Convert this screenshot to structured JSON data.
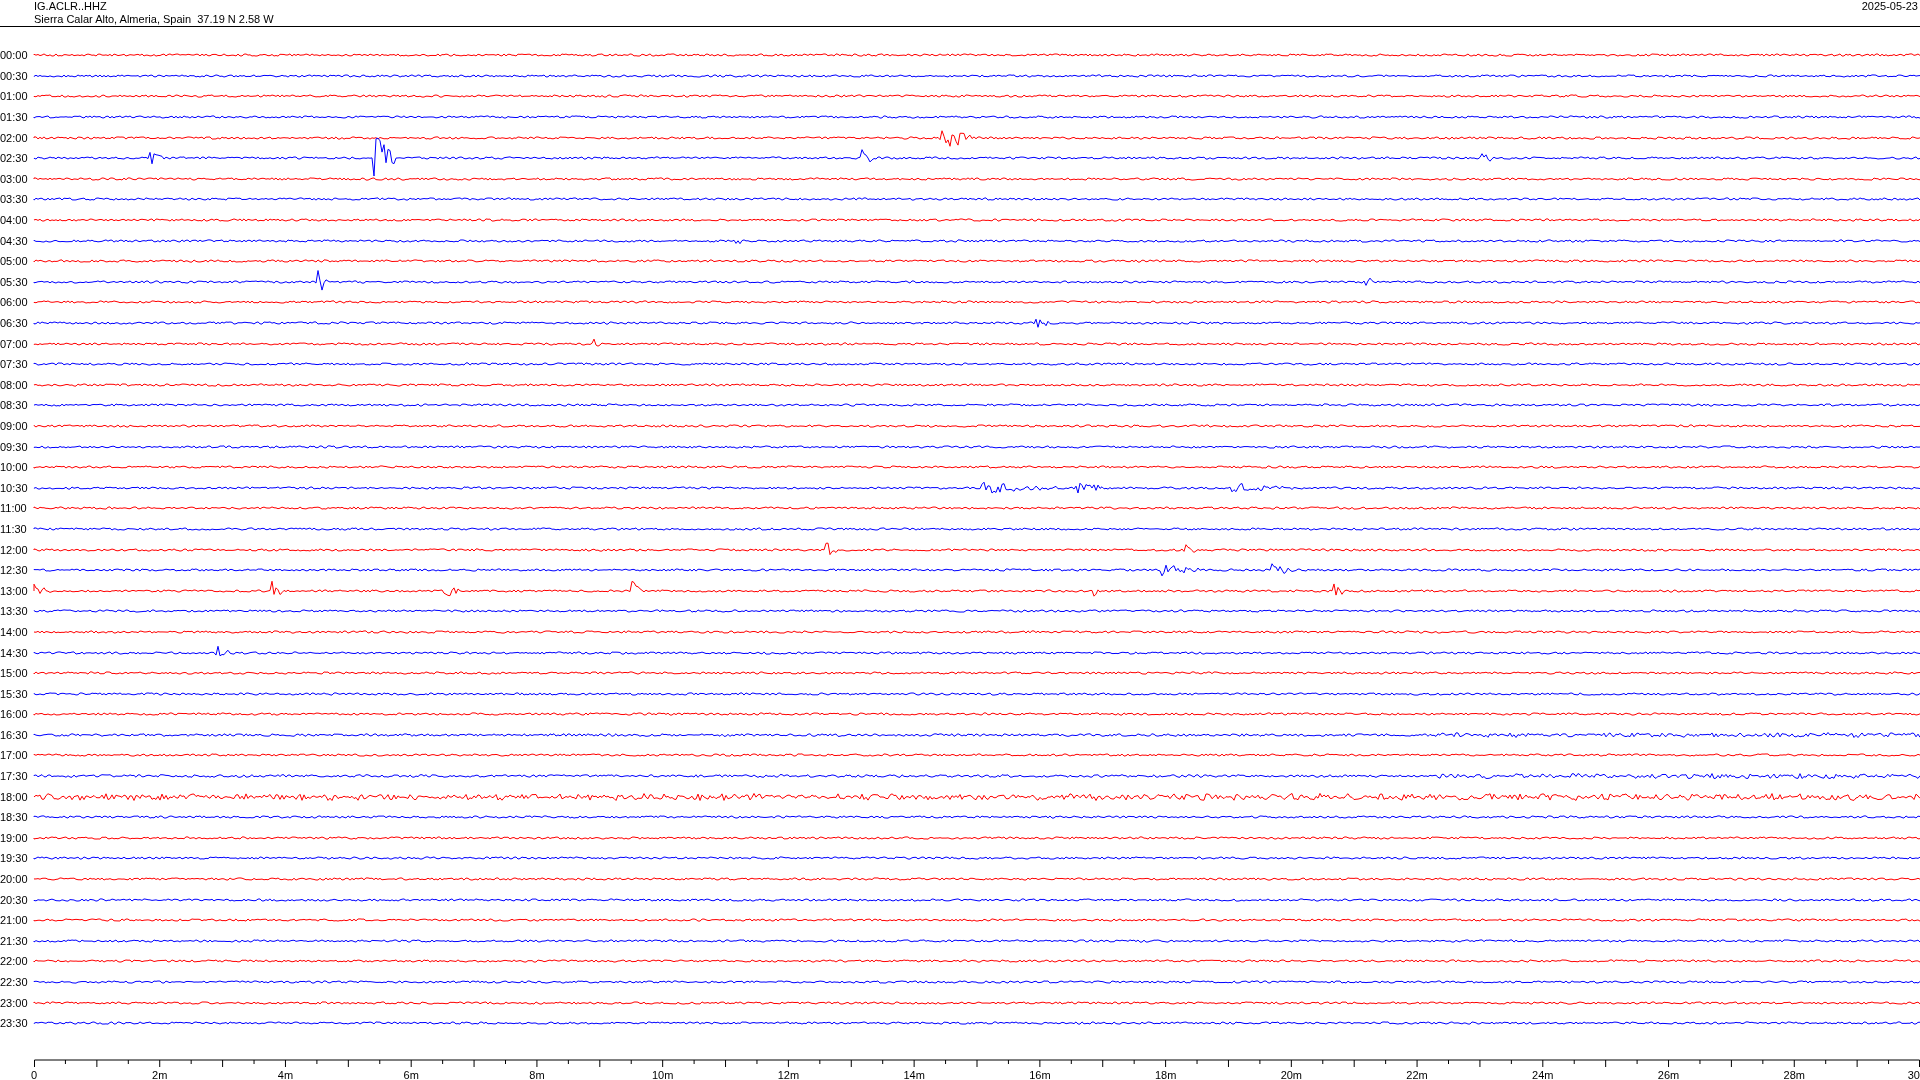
{
  "header": {
    "station": "IG.ACLR..HHZ",
    "location": "Sierra Calar Alto, Almeria, Spain  37.19 N 2.58 W",
    "date": "2025-05-23"
  },
  "rows": [
    {
      "time": "00:00",
      "color": "#ff0000"
    },
    {
      "time": "00:30",
      "color": "#0000ff"
    },
    {
      "time": "01:00",
      "color": "#ff0000"
    },
    {
      "time": "01:30",
      "color": "#0000ff"
    },
    {
      "time": "02:00",
      "color": "#ff0000"
    },
    {
      "time": "02:30",
      "color": "#0000ff"
    },
    {
      "time": "03:00",
      "color": "#ff0000"
    },
    {
      "time": "03:30",
      "color": "#0000ff"
    },
    {
      "time": "04:00",
      "color": "#ff0000"
    },
    {
      "time": "04:30",
      "color": "#0000ff"
    },
    {
      "time": "05:00",
      "color": "#ff0000"
    },
    {
      "time": "05:30",
      "color": "#0000ff"
    },
    {
      "time": "06:00",
      "color": "#ff0000"
    },
    {
      "time": "06:30",
      "color": "#0000ff"
    },
    {
      "time": "07:00",
      "color": "#ff0000"
    },
    {
      "time": "07:30",
      "color": "#0000ff"
    },
    {
      "time": "08:00",
      "color": "#ff0000"
    },
    {
      "time": "08:30",
      "color": "#0000ff"
    },
    {
      "time": "09:00",
      "color": "#ff0000"
    },
    {
      "time": "09:30",
      "color": "#0000ff"
    },
    {
      "time": "10:00",
      "color": "#ff0000"
    },
    {
      "time": "10:30",
      "color": "#0000ff"
    },
    {
      "time": "11:00",
      "color": "#ff0000"
    },
    {
      "time": "11:30",
      "color": "#0000ff"
    },
    {
      "time": "12:00",
      "color": "#ff0000"
    },
    {
      "time": "12:30",
      "color": "#0000ff"
    },
    {
      "time": "13:00",
      "color": "#ff0000"
    },
    {
      "time": "13:30",
      "color": "#0000ff"
    },
    {
      "time": "14:00",
      "color": "#ff0000"
    },
    {
      "time": "14:30",
      "color": "#0000ff"
    },
    {
      "time": "15:00",
      "color": "#ff0000"
    },
    {
      "time": "15:30",
      "color": "#0000ff"
    },
    {
      "time": "16:00",
      "color": "#ff0000"
    },
    {
      "time": "16:30",
      "color": "#0000ff"
    },
    {
      "time": "17:00",
      "color": "#ff0000"
    },
    {
      "time": "17:30",
      "color": "#0000ff"
    },
    {
      "time": "18:00",
      "color": "#ff0000"
    },
    {
      "time": "18:30",
      "color": "#0000ff"
    },
    {
      "time": "19:00",
      "color": "#ff0000"
    },
    {
      "time": "19:30",
      "color": "#0000ff"
    },
    {
      "time": "20:00",
      "color": "#ff0000"
    },
    {
      "time": "20:30",
      "color": "#0000ff"
    },
    {
      "time": "21:00",
      "color": "#ff0000"
    },
    {
      "time": "21:30",
      "color": "#0000ff"
    },
    {
      "time": "22:00",
      "color": "#ff0000"
    },
    {
      "time": "22:30",
      "color": "#0000ff"
    },
    {
      "time": "23:00",
      "color": "#ff0000"
    },
    {
      "time": "23:30",
      "color": "#0000ff"
    }
  ],
  "axis": {
    "labels": [
      "0",
      "2m",
      "4m",
      "6m",
      "8m",
      "10m",
      "12m",
      "14m",
      "16m",
      "18m",
      "20m",
      "22m",
      "24m",
      "26m",
      "28m",
      "30"
    ]
  }
}
